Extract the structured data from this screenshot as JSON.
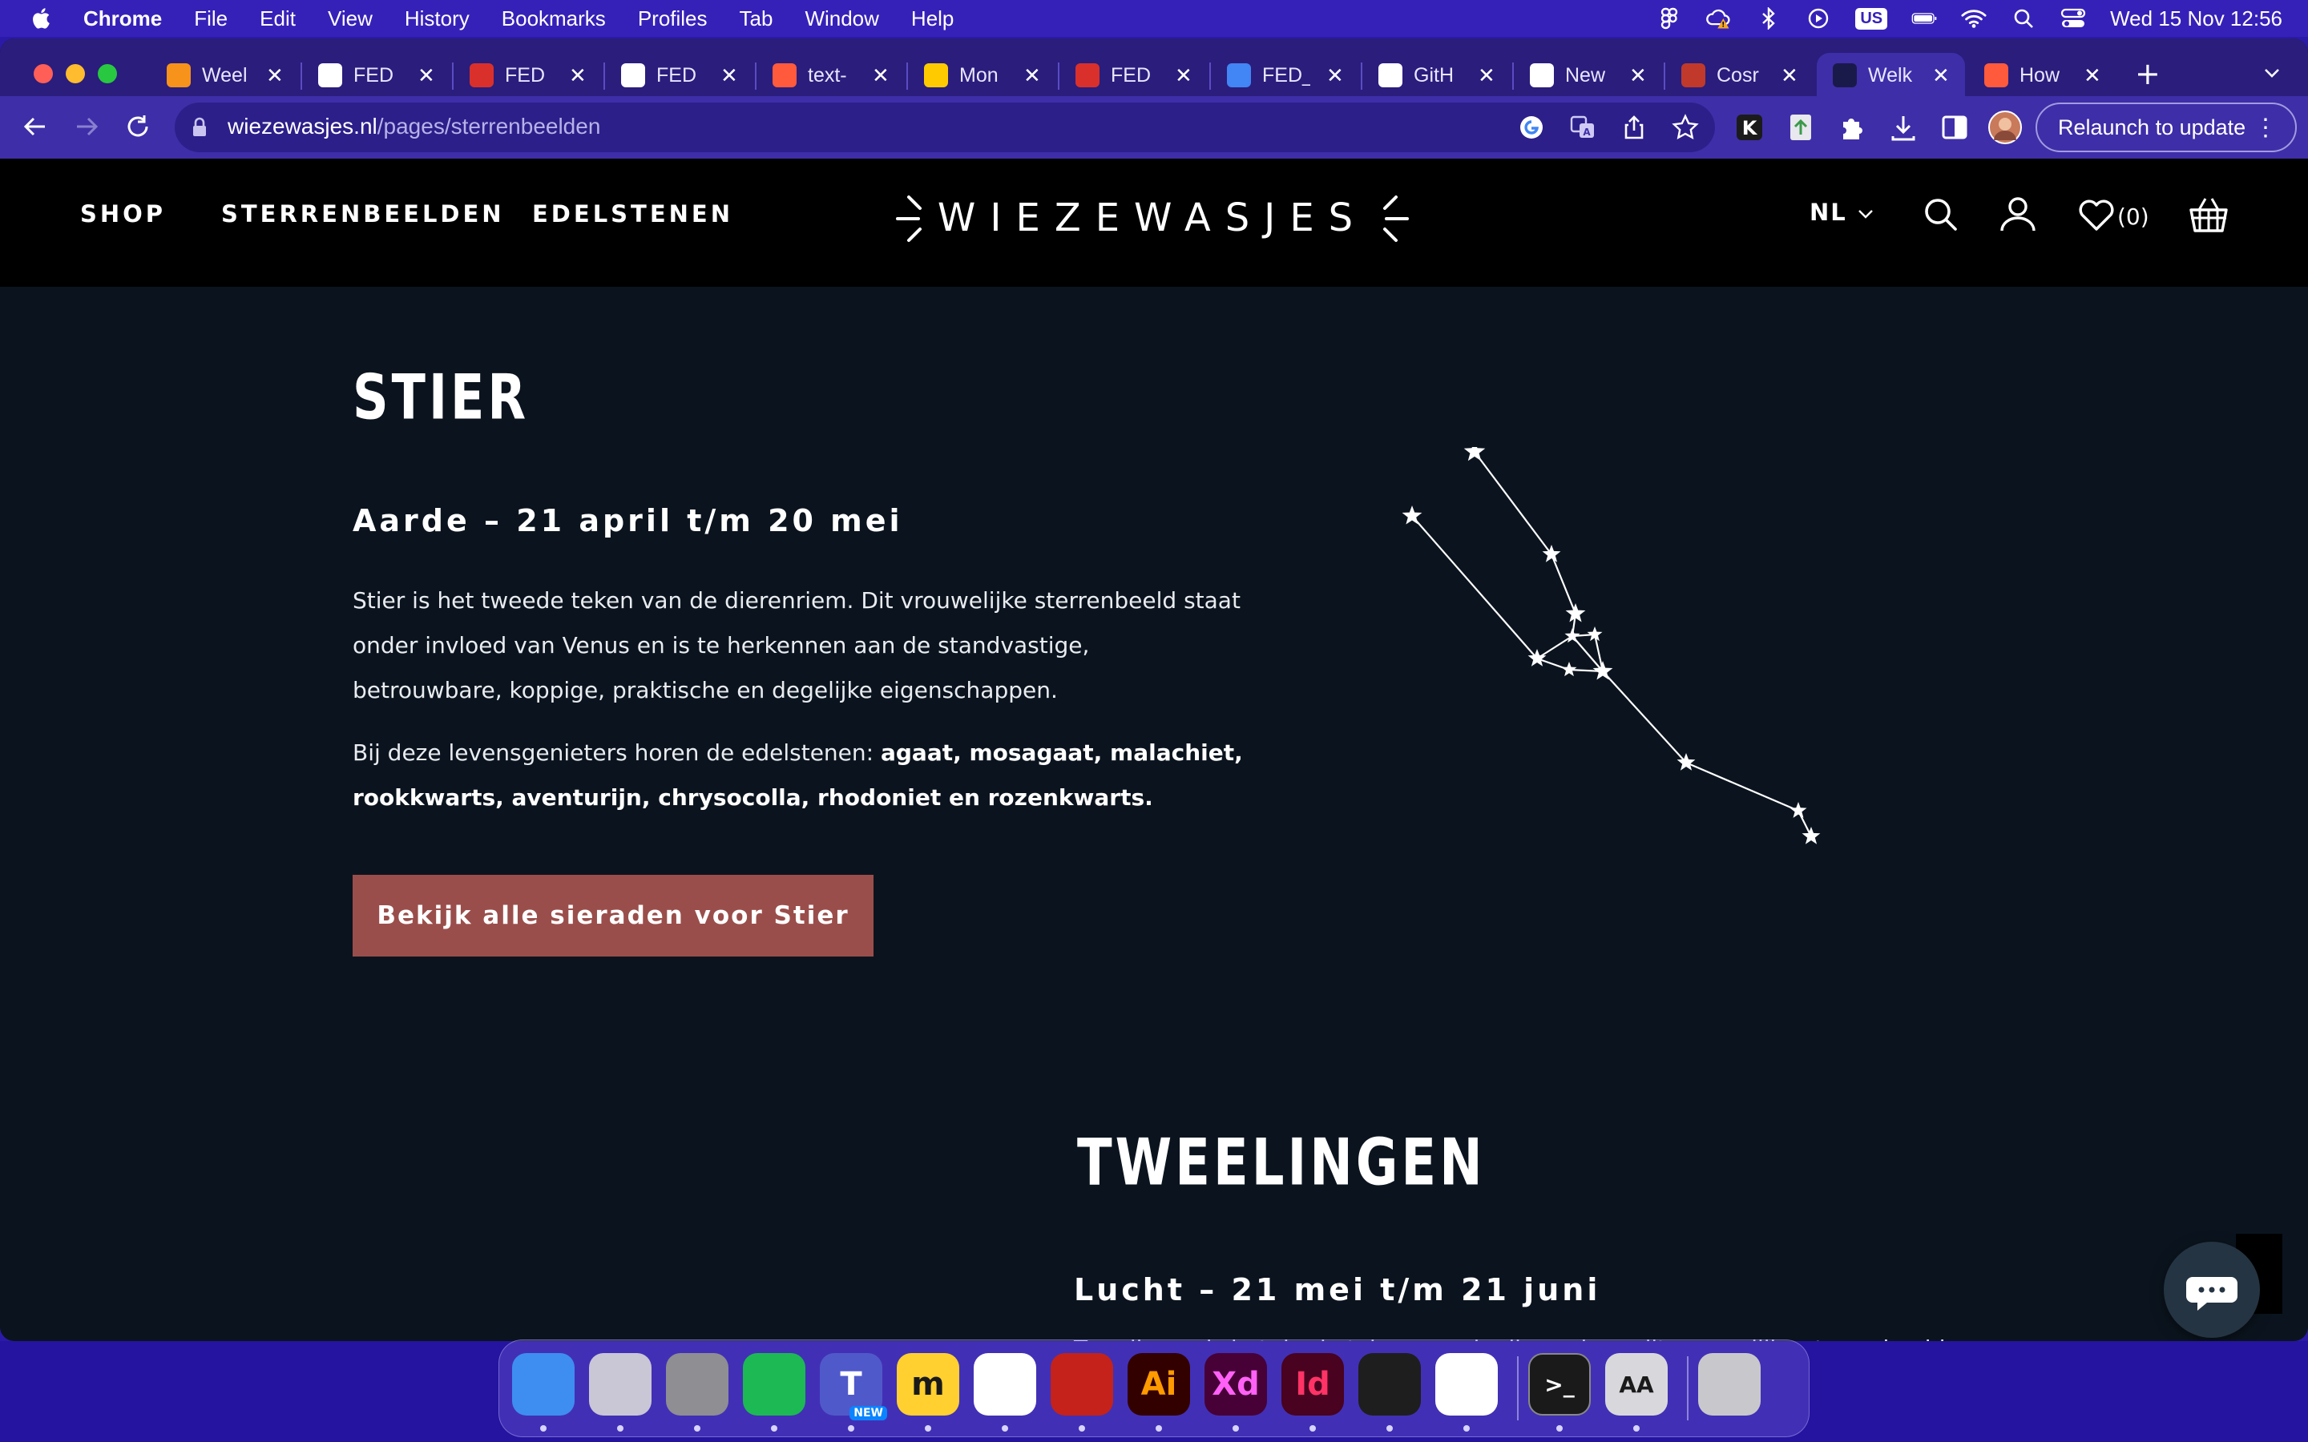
{
  "menubar": {
    "app": "Chrome",
    "items": [
      "File",
      "Edit",
      "View",
      "History",
      "Bookmarks",
      "Profiles",
      "Tab",
      "Window",
      "Help"
    ],
    "input_source": "US",
    "clock": "Wed 15 Nov  12:56"
  },
  "tabs": [
    {
      "label": "Weel",
      "favicon": "bitcoin-icon",
      "color": "#f7931a"
    },
    {
      "label": "FED",
      "favicon": "cube-icon",
      "color": "#ffffff"
    },
    {
      "label": "FED",
      "favicon": "pdf-icon",
      "color": "#d9302c"
    },
    {
      "label": "FED",
      "favicon": "cube-icon",
      "color": "#ffffff"
    },
    {
      "label": "text-",
      "favicon": "asterisk-icon",
      "color": "#ff5a3c"
    },
    {
      "label": "Mon",
      "favicon": "monday-icon",
      "color": "#ffcb00"
    },
    {
      "label": "FED",
      "favicon": "pdf-icon",
      "color": "#d9302c"
    },
    {
      "label": "FED_",
      "favicon": "docs-icon",
      "color": "#4285f4"
    },
    {
      "label": "GitH",
      "favicon": "github-icon",
      "color": "#ffffff"
    },
    {
      "label": "New",
      "favicon": "github-icon",
      "color": "#ffffff"
    },
    {
      "label": "Cosr",
      "favicon": "cosmos-icon",
      "color": "#c0392b"
    },
    {
      "label": "Welk",
      "favicon": "star-icon",
      "color": "#1a1a4a",
      "active": true
    },
    {
      "label": "How",
      "favicon": "asterisk-icon",
      "color": "#ff5a3c"
    }
  ],
  "toolbar": {
    "url_host": "wiezewasjes.nl",
    "url_path": "/pages/sterrenbeelden",
    "relaunch_label": "Relaunch to update"
  },
  "site": {
    "nav": [
      "SHOP",
      "STERRENBEELDEN",
      "EDELSTENEN"
    ],
    "logo_text": "WIEZEWASJES",
    "language": "NL",
    "wishlist_count": "(0)"
  },
  "stier": {
    "title": "STIER",
    "subtitle": "Aarde – 21 april t/m 20 mei",
    "para1_lines": [
      "Stier is het tweede teken van de dierenriem. Dit vrouwelijke sterrenbeeld staat",
      "onder invloed van Venus en is te herkennen aan de standvastige,",
      "betrouwbare, koppige, praktische en degelijke eigenschappen."
    ],
    "para2_lead": "Bij deze levensgenieters horen de edelstenen: ",
    "para2_bold_line1": "agaat, mosagaat, malachiet,",
    "para2_bold_line2": "rookkwarts, aventurijn, chrysocolla, rhodoniet en rozenkwarts.",
    "cta_label": "Bekijk alle sieraden voor Stier"
  },
  "tweelingen": {
    "title": "TWEELINGEN",
    "subtitle": "Lucht – 21 mei t/m 21 juni",
    "para_line1": "Tweelingen is het derde teken van de dierenriem, dit mannelijke sterrenbeeld"
  },
  "dock": {
    "apps": [
      {
        "name": "finder-icon",
        "label": "",
        "bg": "#3d8ef0"
      },
      {
        "name": "launchpad-icon",
        "label": "",
        "bg": "#c9c6d6"
      },
      {
        "name": "system-settings-icon",
        "label": "",
        "bg": "#8e8e93"
      },
      {
        "name": "spotify-icon",
        "label": "",
        "bg": "#1db954"
      },
      {
        "name": "teams-icon",
        "label": "T",
        "bg": "#5059c9"
      },
      {
        "name": "miro-icon",
        "label": "m",
        "bg": "#ffd02f"
      },
      {
        "name": "chrome-icon",
        "label": "",
        "bg": "#ffffff"
      },
      {
        "name": "acrobat-icon",
        "label": "",
        "bg": "#c4221a"
      },
      {
        "name": "illustrator-icon",
        "label": "Ai",
        "bg": "#330000"
      },
      {
        "name": "xd-icon",
        "label": "Xd",
        "bg": "#470137"
      },
      {
        "name": "indesign-icon",
        "label": "Id",
        "bg": "#49021f"
      },
      {
        "name": "figma-icon",
        "label": "",
        "bg": "#1e1e1e"
      },
      {
        "name": "vscode-icon",
        "label": "",
        "bg": "#ffffff"
      },
      {
        "name": "terminal-icon",
        "label": ">_",
        "bg": "#1a1a1a"
      },
      {
        "name": "font-book-icon",
        "label": "AA",
        "bg": "#d8d8dc"
      },
      {
        "name": "trash-icon",
        "label": "",
        "bg": "#c8c8cc"
      }
    ],
    "teams_badge": "NEW"
  },
  "colors": {
    "page_bg": "#0b141e",
    "header_bg": "#000000",
    "cta_bg": "#9a4e4b",
    "browser_chrome": "#3e2ea8"
  }
}
